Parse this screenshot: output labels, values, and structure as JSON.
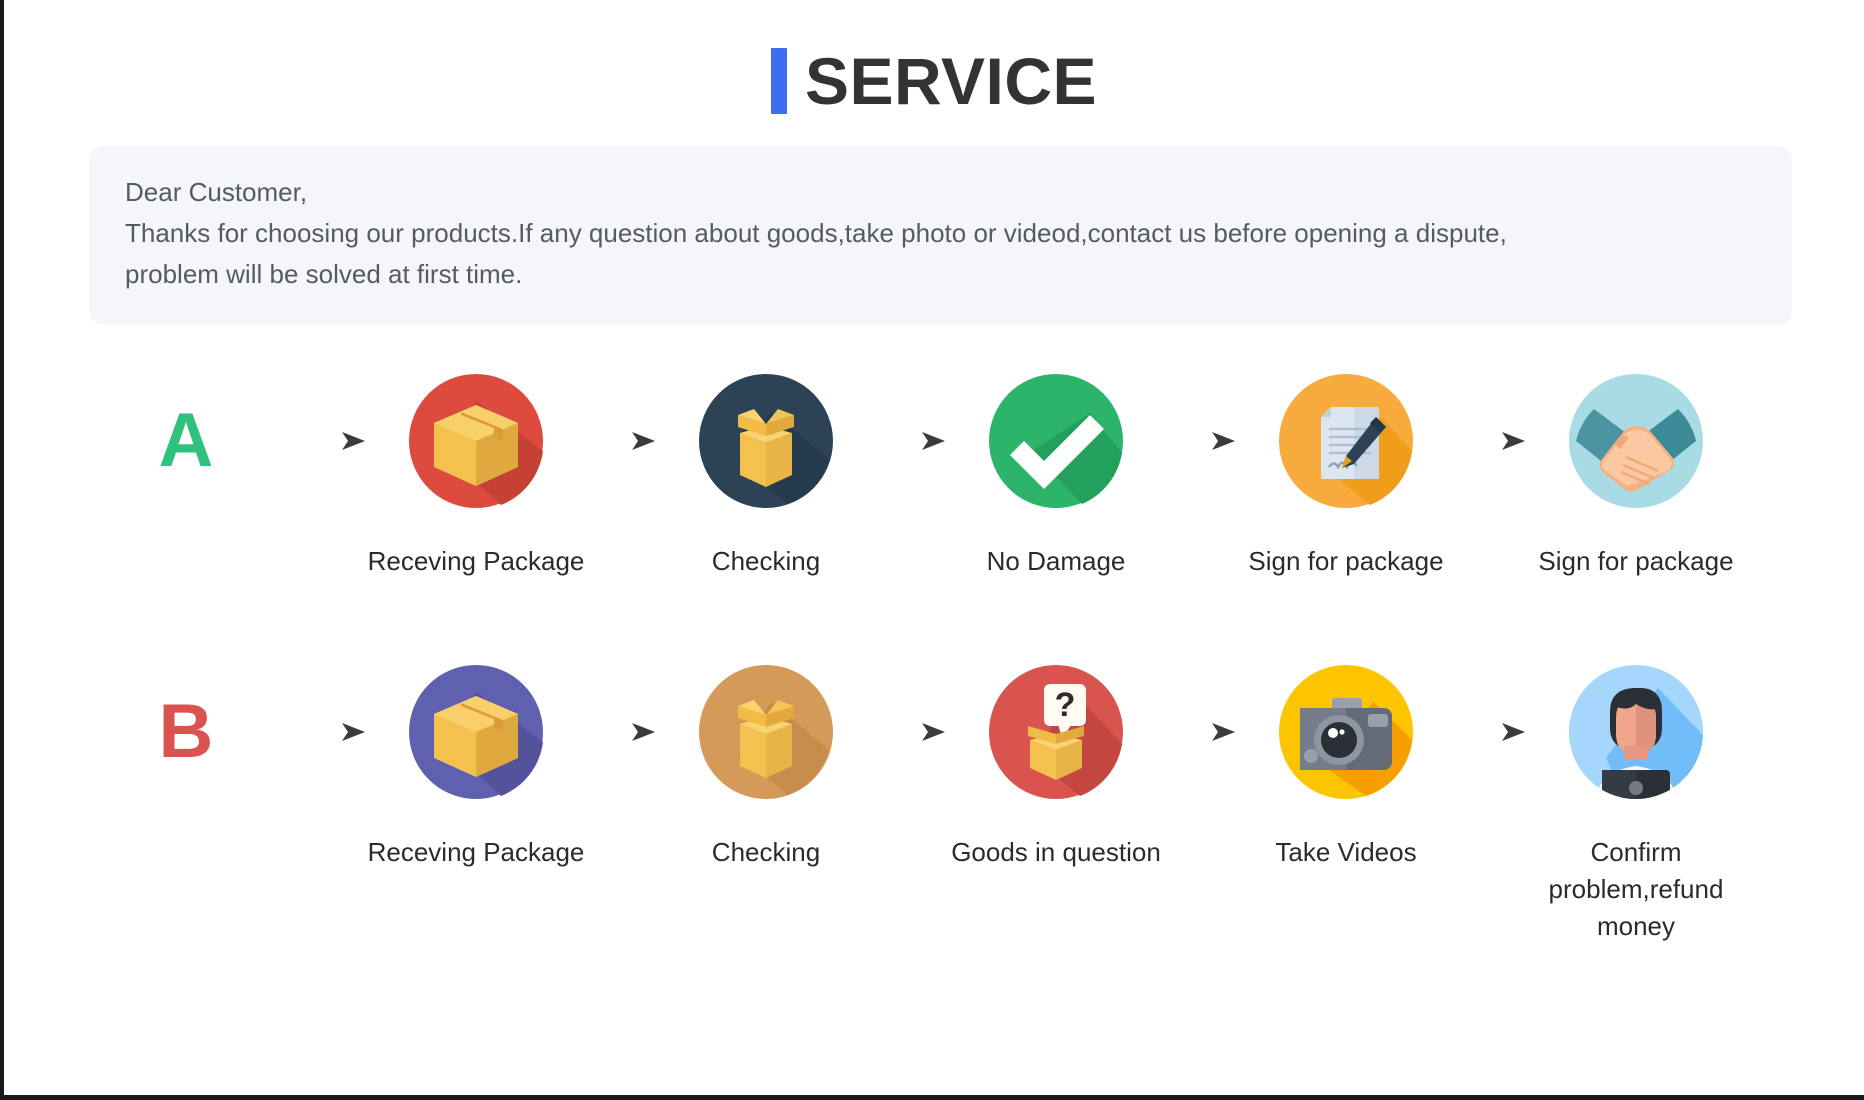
{
  "header": {
    "accent_color": "#3b6ef5",
    "title": "SERVICE"
  },
  "notice": {
    "greeting": "Dear Customer,",
    "body": "Thanks for choosing our products.If any question about goods,take photo or videod,contact us before opening a dispute,\nproblem will be solved at first time.",
    "background_color": "#f5f6fa"
  },
  "flows": [
    {
      "id": "flow-a",
      "letter": "A",
      "letter_color": "#2ec27e",
      "steps": [
        {
          "icon": "closed-box-icon",
          "circle_color": "#dd4b3e",
          "label": "Receving Package"
        },
        {
          "icon": "open-box-icon",
          "circle_color": "#2c4356",
          "label": "Checking"
        },
        {
          "icon": "check-mark-icon",
          "circle_color": "#2cb46b",
          "label": "No Damage"
        },
        {
          "icon": "document-pen-icon",
          "circle_color": "#f7ab3d",
          "label": "Sign for package"
        },
        {
          "icon": "handshake-icon",
          "circle_color": "#a9dbe4",
          "label": "Sign for package"
        }
      ]
    },
    {
      "id": "flow-b",
      "letter": "B",
      "letter_color": "#d9534f",
      "steps": [
        {
          "icon": "closed-box-icon",
          "circle_color": "#6060b0",
          "label": "Receving Package"
        },
        {
          "icon": "open-box-icon",
          "circle_color": "#d69a58",
          "label": "Checking"
        },
        {
          "icon": "question-box-icon",
          "circle_color": "#d9534f",
          "label": "Goods in question"
        },
        {
          "icon": "camera-icon",
          "circle_color": "#fdc500",
          "label": "Take Videos"
        },
        {
          "icon": "support-agent-icon",
          "circle_color": "#93cdf7",
          "label": "Confirm problem,refund money"
        }
      ]
    }
  ]
}
